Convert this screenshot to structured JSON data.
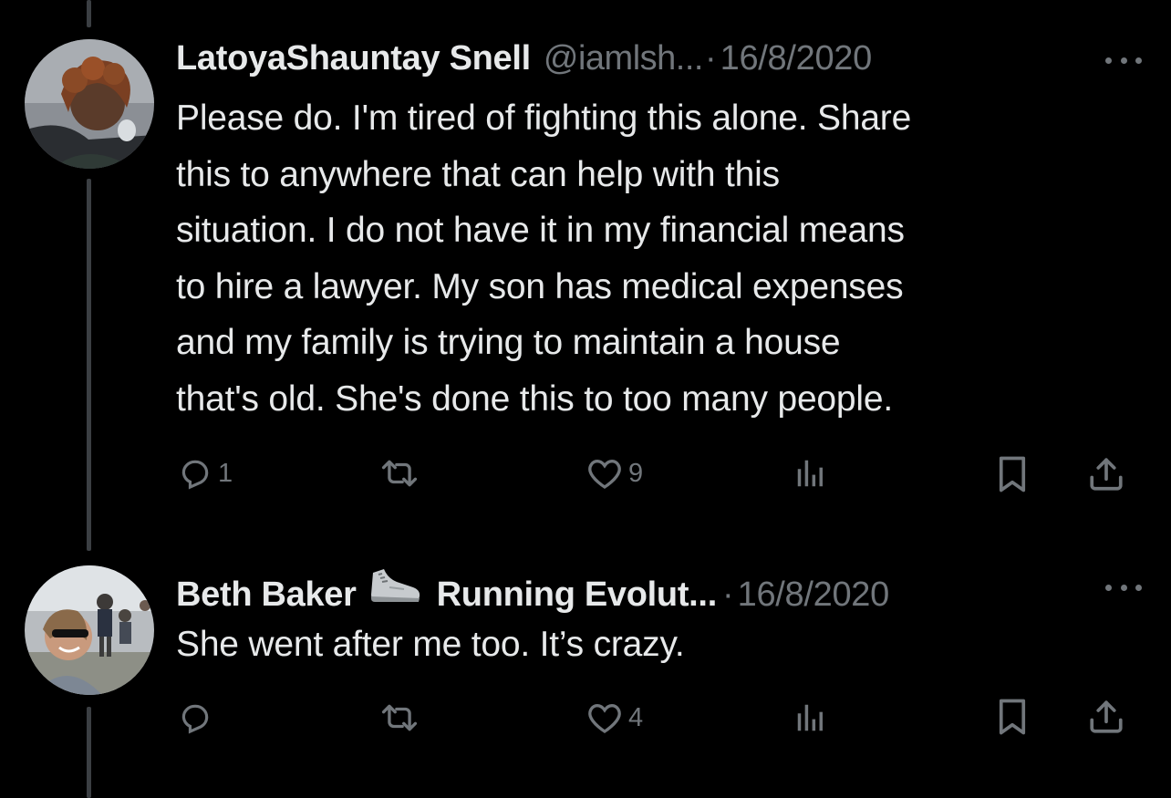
{
  "tweets": [
    {
      "display_name": "LatoyaShauntay Snell",
      "handle": "@iamlsh...",
      "separator": "·",
      "date": "16/8/2020",
      "text": "Please do.  I'm tired of fighting this alone. Share\nthis to anywhere that can help with this\nsituation. I do not have it in my financial means\nto hire a lawyer. My son has medical expenses\nand my family is trying to maintain a house\nthat's old. She's done this to too many people.",
      "reply_count": "1",
      "retweet_count": "",
      "like_count": "9",
      "views_count": ""
    },
    {
      "display_name": "Beth Baker",
      "display_name_suffix": "Running Evolut...",
      "separator": "·",
      "date": "16/8/2020",
      "text": "She went after me too. It’s crazy.",
      "reply_count": "",
      "retweet_count": "",
      "like_count": "4",
      "views_count": ""
    }
  ],
  "icons": {
    "more": "more-icon",
    "reply": "reply-icon",
    "retweet": "retweet-icon",
    "like": "heart-icon",
    "views": "views-icon",
    "bookmark": "bookmark-icon",
    "share": "share-icon",
    "shoe": "running-shoe-emoji"
  },
  "colors": {
    "background": "#000000",
    "primary_text": "#e7e9ea",
    "secondary_text": "#71767b",
    "thread_line": "#3b3f43"
  }
}
